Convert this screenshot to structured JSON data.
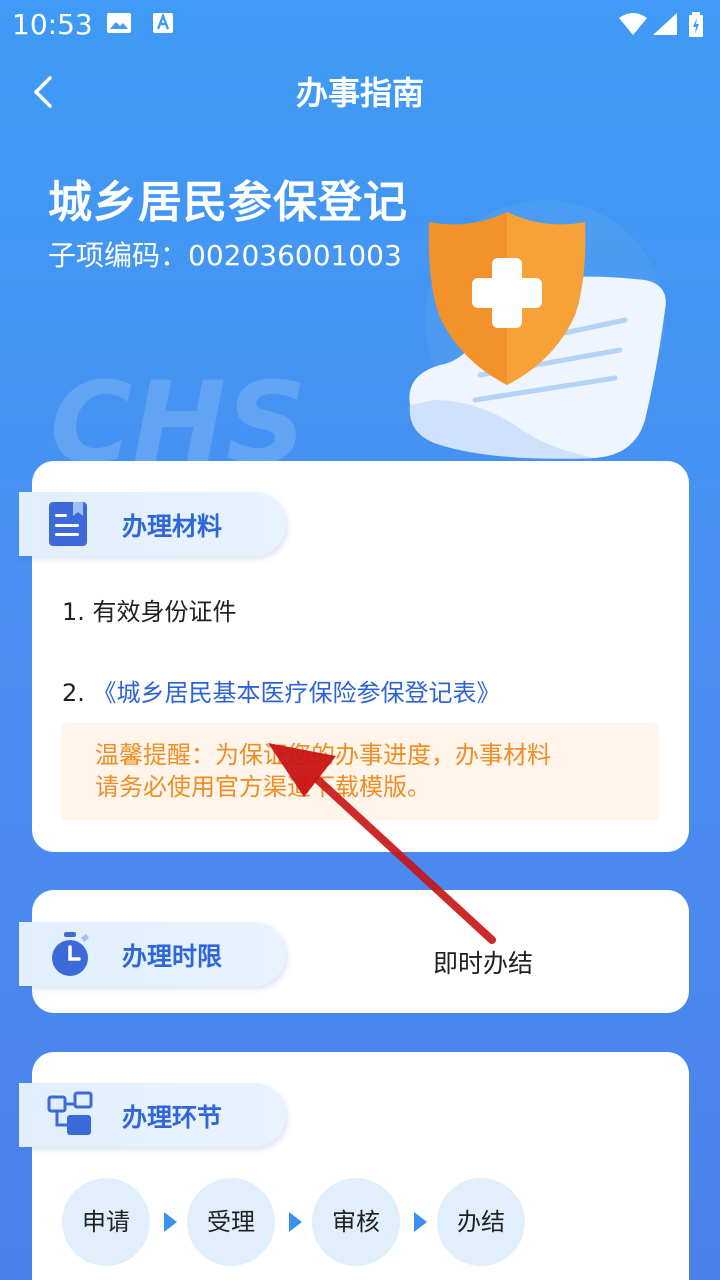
{
  "statusbar": {
    "time": "10:53"
  },
  "nav": {
    "title": "办事指南"
  },
  "hero": {
    "title": "城乡居民参保登记",
    "code_label": "子项编码：002036001003",
    "watermark": "CHS"
  },
  "materials": {
    "tag": "办理材料",
    "items": [
      {
        "text": "1. 有效身份证件"
      },
      {
        "prefix": "2. ",
        "link": "《城乡居民基本医疗保险参保登记表》"
      }
    ],
    "notice_line1": "温馨提醒：为保证您的办事进度，办事材料",
    "notice_line2": "请务必使用官方渠道下载模版。"
  },
  "time_limit": {
    "tag": "办理时限",
    "value": "即时办结"
  },
  "process": {
    "tag": "办理环节",
    "steps": [
      "申请",
      "受理",
      "审核",
      "办结"
    ]
  },
  "colors": {
    "primary_blue": "#2f67d8",
    "notice_orange": "#f08d24",
    "notice_bg": "#fff5eb",
    "annotation_red": "#c81414"
  }
}
